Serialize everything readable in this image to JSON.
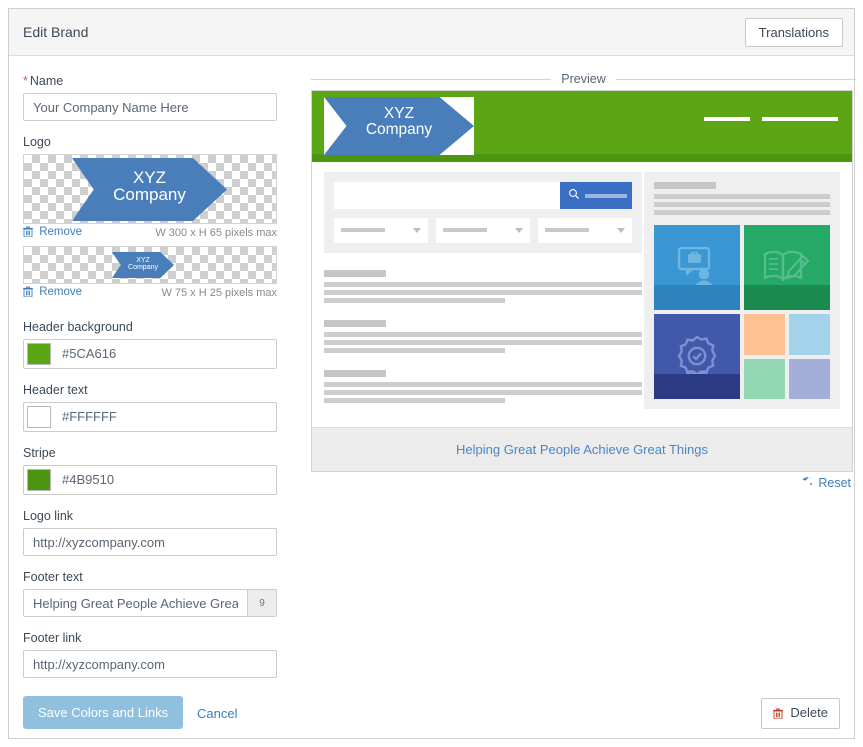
{
  "window": {
    "title": "Edit Brand",
    "translations_button": "Translations"
  },
  "form": {
    "name": {
      "label": "Name",
      "required_mark": "*",
      "value": "Your Company Name Here"
    },
    "logo": {
      "label": "Logo",
      "large": {
        "remove_label": "Remove",
        "remove_icon": "trash-icon",
        "dimensions": "W 300 x H 65 pixels max",
        "text_line1": "XYZ",
        "text_line2": "Company"
      },
      "small": {
        "remove_label": "Remove",
        "remove_icon": "trash-icon",
        "dimensions": "W 75 x H 25 pixels max",
        "text_line1": "XYZ",
        "text_line2": "Company"
      }
    },
    "header_background": {
      "label": "Header background",
      "value": "#5CA616"
    },
    "header_text": {
      "label": "Header text",
      "value": "#FFFFFF"
    },
    "stripe": {
      "label": "Stripe",
      "value": "#4B9510"
    },
    "logo_link": {
      "label": "Logo link",
      "value": "http://xyzcompany.com"
    },
    "footer_text": {
      "label": "Footer text",
      "value": "Helping Great People Achieve Great",
      "counter": "9"
    },
    "footer_link": {
      "label": "Footer link",
      "value": "http://xyzcompany.com"
    }
  },
  "actions": {
    "save_label": "Save Colors and Links",
    "cancel_label": "Cancel",
    "delete_label": "Delete",
    "delete_icon": "trash-icon",
    "reset_label": "Reset",
    "reset_icon": "undo-arrow-icon"
  },
  "preview": {
    "title": "Preview",
    "header_logo_line1": "XYZ",
    "header_logo_line2": "Company",
    "footer_link_text": "Helping Great People Achieve Great Things",
    "search_icon": "magnifier-icon",
    "tiles": [
      {
        "name": "briefcase-chat-icon",
        "color": "#3b97d3"
      },
      {
        "name": "book-pencil-icon",
        "color": "#26a866"
      },
      {
        "name": "award-ribbon-icon",
        "color": "#4258ab"
      }
    ],
    "quad_colors": [
      "#fdc193",
      "#a3d3ea",
      "#93d8b2",
      "#a3aed9"
    ]
  },
  "colors": {
    "header_background": "#5CA616",
    "stripe": "#4B9510",
    "header_text": "#FFFFFF",
    "logo_blue": "#4a7ebb",
    "link_blue": "#3d7ebf"
  }
}
